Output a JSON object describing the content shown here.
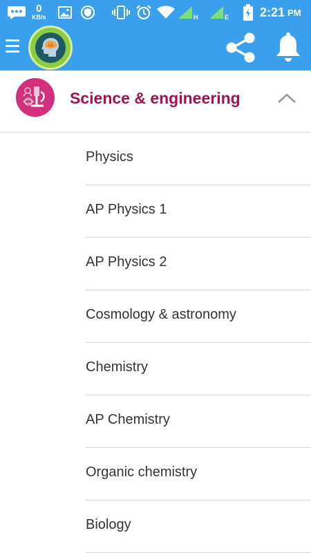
{
  "status_bar": {
    "net_speed_value": "0",
    "net_speed_unit": "KB/s",
    "network_1": "H",
    "network_2": "E",
    "time": "2:21",
    "ampm": "PM"
  },
  "app_bar": {
    "color": "#3aa0ee",
    "icons": [
      "menu-icon",
      "brain-logo-icon",
      "share-icon",
      "bell-icon"
    ]
  },
  "category": {
    "title": "Science & engineering",
    "title_color": "#a3124f",
    "icon_color": "#d22f7c",
    "expanded": true
  },
  "subjects": [
    "Physics",
    "AP Physics 1",
    "AP Physics 2",
    "Cosmology & astronomy",
    "Chemistry",
    "AP Chemistry",
    "Organic chemistry",
    "Biology"
  ]
}
